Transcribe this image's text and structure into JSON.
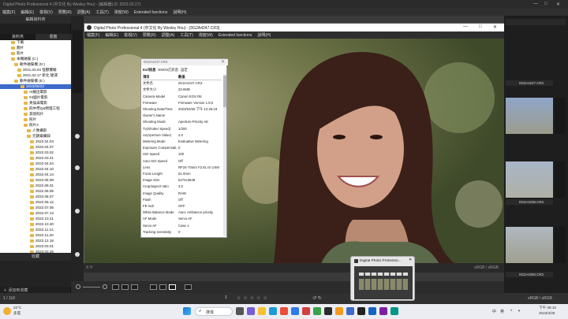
{
  "outer": {
    "title": "Digital Photo Professional 4 (中文化 By Wesley Hou) - [編輯器] (0: 2023.03.27)",
    "menu": [
      "檔案(F)",
      "編輯(E)",
      "檢視(V)",
      "預覽(R)",
      "調整(A)",
      "工具(T)",
      "視窗(W)",
      "Extended functions",
      "說明(H)"
    ]
  },
  "left": {
    "header": "編輯資料夾",
    "tabs": [
      "資料夾",
      "書籤"
    ],
    "tree": [
      "下載",
      "圖片",
      "影片",
      "本機磁碟 (C:)",
      "軟件磁碟機 (D:)",
      "2021.03.04 怪獸實驗",
      "2021.03.17 新北 捷運",
      "軟件磁碟機 (E:)",
      "2023/05/22",
      "AI繪出電影",
      "#4國片電影",
      "英倫與電影",
      "四中學Q&物理工程",
      "其他照片",
      "照片",
      "照片2",
      "人像攝影",
      "元錦桑攝錄",
      "2022.04.04",
      "2022.04.07",
      "2022.03.02",
      "2022.03.21",
      "2022.04.04",
      "2022.04.10",
      "2022.04.14",
      "2022.05.08",
      "2022.06.01",
      "2022.06.05",
      "2022.06.07",
      "2022.06.12",
      "2022.07.05",
      "2022.07.13",
      "2022.10.21",
      "2022.10.30",
      "2022.11.14",
      "2022.11.20",
      "2022.12.18",
      "2023.03.01",
      "2023.03.25"
    ],
    "save_header": "收藏",
    "add_fav": "＋ 添加到收藏"
  },
  "inner": {
    "title": "Digital Photo Professional 4 (中文化 By Wesley Hou) - [0G2A4247.CR3]",
    "menu": [
      "檔案(F)",
      "編輯(E)",
      "檢視(V)",
      "預覽(R)",
      "調整(A)",
      "工具(T)",
      "視窗(W)",
      "Extended functions",
      "說明(H)"
    ]
  },
  "info": {
    "title": "0G2A4247.CR3",
    "tabs": [
      "Exif訊息",
      "EMOS訂訊息",
      "設定"
    ],
    "header": [
      "項目",
      "數值"
    ],
    "rows": [
      [
        "文件名",
        "0G2A4247.CR3"
      ],
      [
        "文件大小",
        "23.6MB"
      ],
      [
        "Camera Model",
        "Canon EOS R6"
      ],
      [
        "Firmware",
        "Firmware Version 1.8.0"
      ],
      [
        "Shooting Date/Time",
        "2023/03/26 下午 12:26:19"
      ],
      [
        "Owner's Name",
        ""
      ],
      [
        "Shooting Mode",
        "Aperture-Priority AE"
      ],
      [
        "Tv(Shutter Speed)",
        "1/200"
      ],
      [
        "Av(Aperture Value)",
        "4.0"
      ],
      [
        "Metering Mode",
        "Evaluative Metering"
      ],
      [
        "Exposure Compensati...",
        "0"
      ],
      [
        "ISO Speed",
        "100"
      ],
      [
        "Auto ISO Speed",
        "Off"
      ],
      [
        "Lens",
        "RF24-70mm F2.8L IS USM"
      ],
      [
        "Focal Length",
        "61.0mm"
      ],
      [
        "Image Size",
        "5472x3648"
      ],
      [
        "Crop/aspect ratio",
        "3:2"
      ],
      [
        "Image Quality",
        "RAW"
      ],
      [
        "Flash",
        "Off"
      ],
      [
        "FE lock",
        "OFF"
      ],
      [
        "White Balance Mode",
        "Auto: Ambience priority"
      ],
      [
        "AF Mode",
        "Servo AF"
      ],
      [
        "Servo AF",
        "Case 1"
      ],
      [
        "Tracking sensitivity",
        "0"
      ]
    ]
  },
  "right": {
    "labels": [
      "0G2A4247.CR3",
      "0G2A4236.CR3",
      "0G2A4250.CR3"
    ]
  },
  "status": {
    "left": "X:Y:",
    "right": "sRGB / sRGB"
  },
  "footer": {
    "left": "1 / 118",
    "zoom_label": "1",
    "right": "sRGB / sRGB"
  },
  "popup": {
    "title": "Digital Photo Professio..."
  },
  "taskbar": {
    "weather_temp": "22°C",
    "weather_desc": "多雲",
    "search": "搜尋",
    "time": "下午 08:10",
    "date": "2023/3/29",
    "ime": "英",
    "lang": "中"
  }
}
